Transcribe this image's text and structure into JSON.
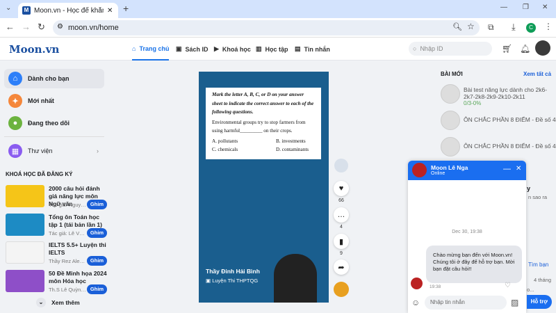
{
  "browser": {
    "tab_title": "Moon.vn - Học để khẳng định mình",
    "url": "moon.vn/home",
    "profile": "C"
  },
  "site": {
    "logo": "Moon.vn",
    "nav": [
      "Trang chủ",
      "Sách ID",
      "Khoá học",
      "Học tập",
      "Tin nhắn"
    ],
    "search_placeholder": "Nhập ID"
  },
  "sidebar": {
    "items": [
      "Dành cho bạn",
      "Mới nhất",
      "Đang theo dõi",
      "Thư viện"
    ],
    "courses_heading": "KHOÁ HỌC ĐÃ ĐĂNG KÝ",
    "courses": [
      {
        "title": "2000 câu hỏi đánh giá năng lực môn Ngữ văn",
        "author": "Tác giả: Nguyễn ...",
        "btn": "Ghim"
      },
      {
        "title": "Tổng ôn Toán học tập 1 (tái bản lần 1)",
        "author": "Tác giả: Lê Văn T...",
        "btn": "Ghim"
      },
      {
        "title": "IELTS 5.5+ Luyện thi IELTS",
        "author": "Thầy Rez Alexis ...",
        "btn": "Ghim"
      },
      {
        "title": "50 Đề Minh họa 2024 môn Hóa học",
        "author": "Th.S Lê Quỳnh Tr...",
        "btn": "Ghim"
      }
    ],
    "more": "Xem thêm"
  },
  "video": {
    "question_instruction": "Mark the letter A, B, C, or D on your answer sheet to indicate the correct answer to each of the following questions.",
    "question": "Environmental groups try to stop farmers from using harmful_________ on their crops.",
    "options": [
      "A. pollutants",
      "B. investments",
      "C. chemicals",
      "D. contaminants"
    ],
    "teacher": "Thầy Đinh Hải Bình",
    "channel": "Luyện Thi THPTQG",
    "likes": "66",
    "comments": "4",
    "saves": "9"
  },
  "right": {
    "heading": "BÀI MỚI",
    "see_all": "Xem tất cả",
    "posts": [
      {
        "title": "Bài test năng lực dành cho 2k6-2k7-2k8-2k9-2k10-2k11",
        "progress": "0/3-0%"
      },
      {
        "title": "ÔN CHẮC PHẦN 8 ĐIỂM - Đề số 4"
      },
      {
        "title": "ÔN CHẮC PHẦN 8 ĐIỂM - Đề số 4"
      }
    ],
    "hidden_fragments": [
      "y",
      "n sao ra",
      "Tìm bạn",
      "4 tháng",
      "o..."
    ]
  },
  "chat": {
    "name": "Moon Lê Nga",
    "status": "Online",
    "date": "Dec 30, 19:38",
    "message": "Chào mừng bạn đến với Moon.vn! Chúng tôi ở đây để hỗ trợ bạn. Mời bạn đặt câu hỏi!!",
    "time": "19:38",
    "input_placeholder": "Nhập tin nhắn",
    "support_btn": "Hỗ trợ"
  }
}
